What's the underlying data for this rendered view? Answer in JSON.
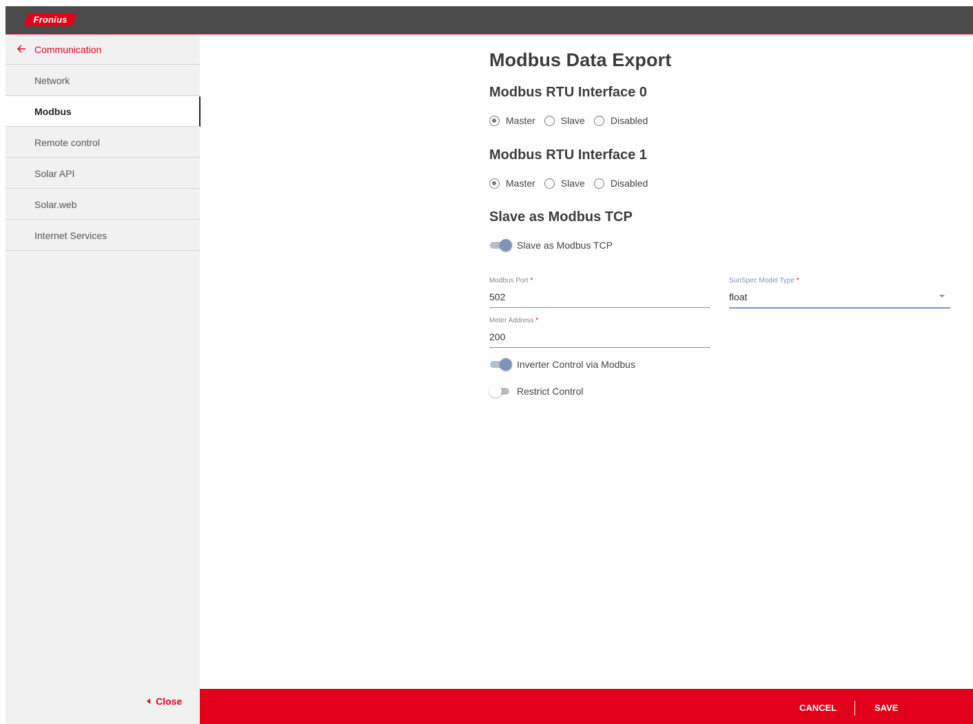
{
  "header": {
    "logo_text": "Fronius",
    "brand_color": "#e2001a",
    "bar_color": "#4b4b4b"
  },
  "sidebar": {
    "back_label": "Communication",
    "items": [
      {
        "label": "Network",
        "active": false
      },
      {
        "label": "Modbus",
        "active": true
      },
      {
        "label": "Remote control",
        "active": false
      },
      {
        "label": "Solar API",
        "active": false
      },
      {
        "label": "Solar.web",
        "active": false
      },
      {
        "label": "Internet Services",
        "active": false
      }
    ],
    "close_label": "Close"
  },
  "main": {
    "title": "Modbus Data Export",
    "rtu0": {
      "heading": "Modbus RTU Interface 0",
      "options": [
        "Master",
        "Slave",
        "Disabled"
      ],
      "selected": "Master"
    },
    "rtu1": {
      "heading": "Modbus RTU Interface 1",
      "options": [
        "Master",
        "Slave",
        "Disabled"
      ],
      "selected": "Master"
    },
    "tcp": {
      "heading": "Slave as Modbus TCP",
      "toggle_label": "Slave as Modbus TCP",
      "toggle_on": true
    },
    "fields": {
      "port": {
        "label": "Modbus Port",
        "required_mark": "*",
        "value": "502"
      },
      "sunspec": {
        "label": "SunSpec Model Type",
        "required_mark": "*",
        "value": "float"
      },
      "meter": {
        "label": "Meter Address",
        "required_mark": "*",
        "value": "200"
      }
    },
    "inverter_control": {
      "label": "Inverter Control via Modbus",
      "on": true
    },
    "restrict_control": {
      "label": "Restrict Control",
      "on": false
    }
  },
  "footer": {
    "cancel_label": "CANCEL",
    "save_label": "SAVE"
  }
}
